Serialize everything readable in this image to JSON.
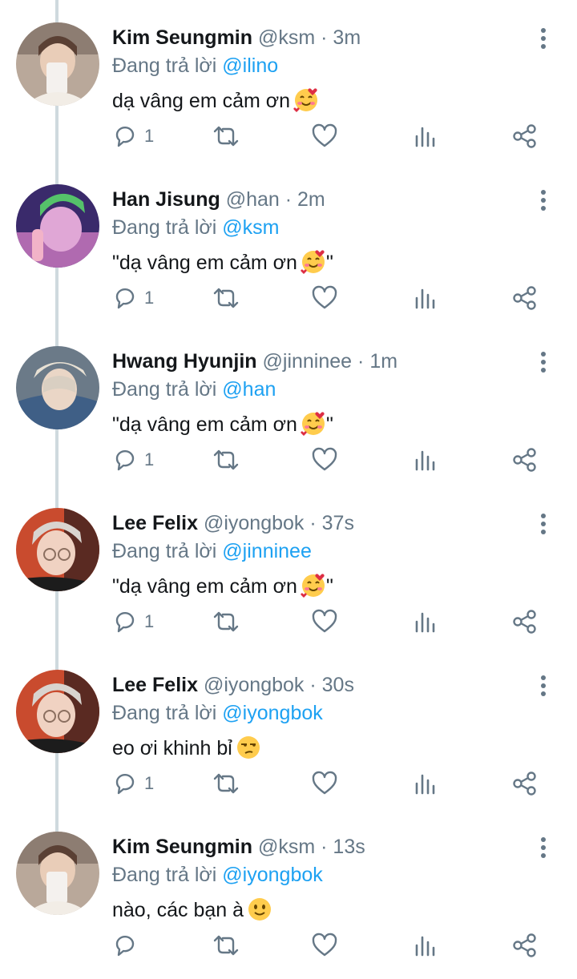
{
  "reply_prefix": "Đang trả lời",
  "tweets": [
    {
      "name": "Kim Seungmin",
      "handle": "@ksm",
      "time": "3m",
      "reply_to": "@ilino",
      "text": "dạ vâng em cảm ơn",
      "emoji": "smiling-face-with-hearts",
      "reply_count": "1"
    },
    {
      "name": "Han Jisung",
      "handle": "@han",
      "time": "2m",
      "reply_to": "@ksm",
      "text": "\"dạ vâng em cảm ơn",
      "text_after": "\"",
      "emoji": "smiling-face-with-hearts",
      "reply_count": "1"
    },
    {
      "name": "Hwang Hyunjin",
      "handle": "@jinninee",
      "time": "1m",
      "reply_to": "@han",
      "text": "\"dạ vâng em cảm ơn",
      "text_after": "\"",
      "emoji": "smiling-face-with-hearts",
      "reply_count": "1"
    },
    {
      "name": "Lee Felix",
      "handle": "@iyongbok",
      "time": "37s",
      "reply_to": "@jinninee",
      "text": "\"dạ vâng em cảm ơn",
      "text_after": "\"",
      "emoji": "smiling-face-with-hearts",
      "reply_count": "1"
    },
    {
      "name": "Lee Felix",
      "handle": "@iyongbok",
      "time": "30s",
      "reply_to": "@iyongbok",
      "text": "eo ơi khinh bỉ",
      "emoji": "unamused-face",
      "reply_count": "1"
    },
    {
      "name": "Kim Seungmin",
      "handle": "@ksm",
      "time": "13s",
      "reply_to": "@iyongbok",
      "text": "nào, các bạn à",
      "emoji": "slightly-smiling-face",
      "reply_count": ""
    }
  ],
  "colors": {
    "mention": "#1da1f2",
    "secondary": "#657786",
    "text": "#14171a",
    "thread_line": "#cfd9de"
  }
}
